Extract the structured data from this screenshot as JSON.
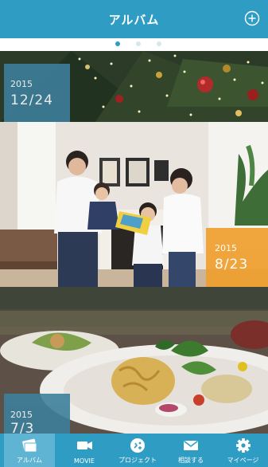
{
  "header": {
    "title": "アルバム",
    "add_icon": "plus-circle-icon"
  },
  "pager": {
    "pages": 3,
    "active_page": 1
  },
  "albums": [
    {
      "year": "2015",
      "date": "12/24",
      "badge_color": "#3d7f9b",
      "scene": "christmas-tree"
    },
    {
      "year": "2015",
      "date": "8/23",
      "badge_color": "#f0a02e",
      "scene": "family-in-living-room"
    },
    {
      "year": "2015",
      "date": "7/3",
      "badge_color": "#3d7f9b",
      "scene": "plated-pasta-dish"
    }
  ],
  "tabs": [
    {
      "label": "アルバム",
      "icon": "album-icon",
      "active": true
    },
    {
      "label": "MOVIE",
      "icon": "video-camera-icon",
      "active": false
    },
    {
      "label": "プロジェクト",
      "icon": "project-icon",
      "active": false
    },
    {
      "label": "相談する",
      "icon": "mail-icon",
      "active": false
    },
    {
      "label": "マイページ",
      "icon": "gear-icon",
      "active": false
    }
  ],
  "colors": {
    "brand": "#2f9cc3",
    "active_tab": "#5fb4d4"
  }
}
